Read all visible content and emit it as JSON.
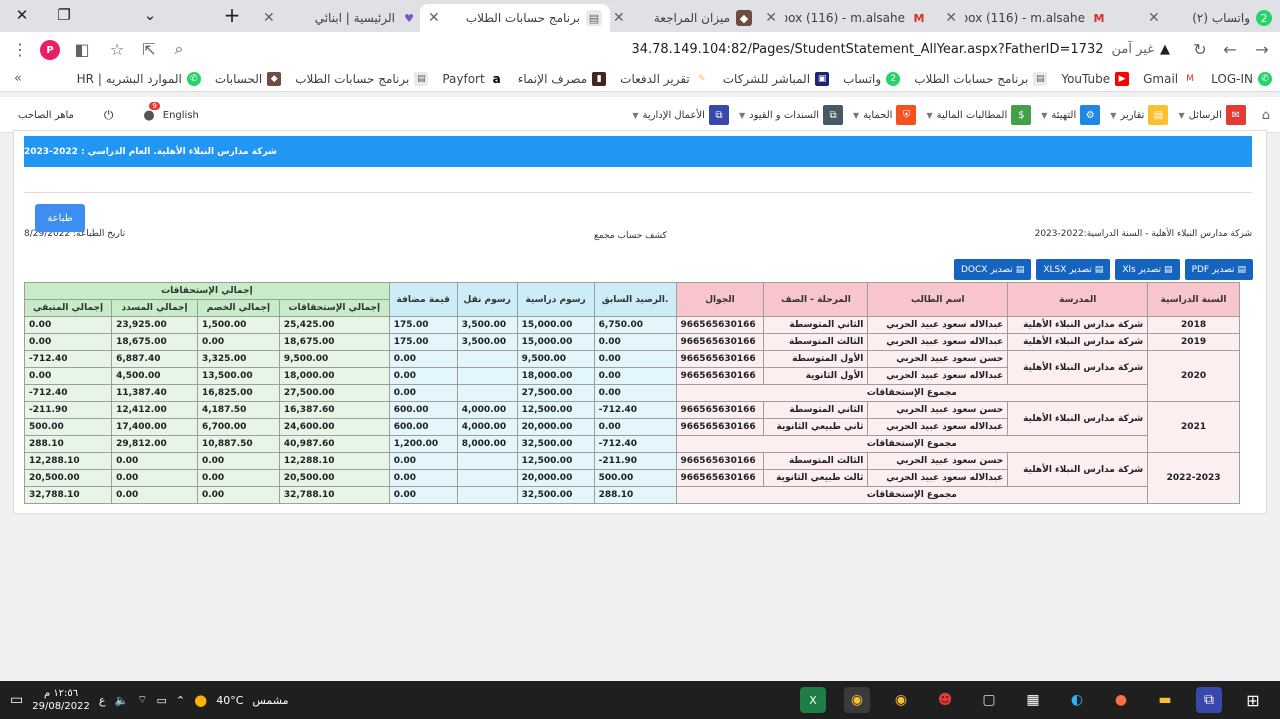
{
  "browser": {
    "tabs": [
      {
        "title": "واتساب (٢)",
        "icon": "whatsapp-icon",
        "badge": "2"
      },
      {
        "title": "Inbox (116) - m.alsahe",
        "icon": "gmail-icon"
      },
      {
        "title": "Inbox (116) - m.alsahe",
        "icon": "gmail-icon"
      },
      {
        "title": "ميزان المراجعة",
        "icon": "app-icon"
      },
      {
        "title": "برنامج حسابات الطلاب",
        "icon": "doc-icon"
      },
      {
        "title": "الرئيسية | ابنائي",
        "icon": "heart-icon"
      }
    ],
    "new_tab": "+",
    "address": {
      "security": "غير آمن",
      "url": "34.78.149.104:82/Pages/StudentStatement_AllYear.aspx?FatherID=1732"
    },
    "profile_letter": "P",
    "bookmarks": [
      "LOG-IN",
      "Gmail",
      "YouTube",
      "برنامج حسابات الطلاب",
      "واتساب",
      "المباشر للشركات",
      "تقرير الدفعات",
      "مصرف الإنماء",
      "Payfort",
      "برنامج حسابات الطلاب",
      "الحسابات",
      "الموارد البشريه | HR"
    ],
    "bookmarks_more": "»"
  },
  "app": {
    "menu": [
      "الرسائل",
      "تقارير",
      "التهيئة",
      "المطالبات المالية",
      "الحماية",
      "السندات و القيود",
      "الأعمال الإدارية"
    ],
    "lang": "English",
    "notif_count": "9",
    "user": "ماهر الصاحب",
    "colors": {
      "accent": "#2196f3",
      "export": "#1565c0"
    }
  },
  "report": {
    "header": "شركة مدارس النبلاء الأهلية. العام الدراسي : 2022-2023",
    "print_btn": "طباعة",
    "print_date": "تاريخ الطباعة: 8/29/2022",
    "title": "كشف حساب مجمع",
    "school_year": "شركة مدارس النبلاء الأهلية  - السنة الدراسية:2022-2023",
    "exports": [
      "تصدير PDF",
      "تصدير Xls",
      "تصدير XLSX",
      "تصدير DOCX"
    ],
    "columns": {
      "year": "السنة الدراسية",
      "school": "المدرسة",
      "student": "اسم الطالب",
      "grade": "المرحلة - الصف",
      "mobile": "الجوال",
      "prev": ".الرصيد السابق",
      "tuition": "رسوم دراسية",
      "transport": "رسوم نقل",
      "vat": "قيمة مضافة",
      "group": "إجمالي الإستحقاقات",
      "total_due": "إجمالي الإستحقاقات",
      "discount": "إجمالي الخصم",
      "paid": "إجمالي المسدد",
      "remaining": "إجمالي المتبقي"
    },
    "total_label": "مجموع الإستحقاقات",
    "school_name": "شركة مدارس النبلاء الأهلية",
    "groups": [
      {
        "year": "2018",
        "rows": [
          {
            "student": "عبدالاله سعود عبيد الحربي",
            "grade": "الثاني المتوسطة",
            "mobile": "966565630166",
            "prev": "6,750.00",
            "tuition": "15,000.00",
            "transport": "3,500.00",
            "vat": "175.00",
            "total_due": "25,425.00",
            "discount": "1,500.00",
            "paid": "23,925.00",
            "remaining": "0.00"
          }
        ]
      },
      {
        "year": "2019",
        "rows": [
          {
            "student": "عبدالاله سعود عبيد الحربي",
            "grade": "الثالث المتوسطة",
            "mobile": "966565630166",
            "prev": "0.00",
            "tuition": "15,000.00",
            "transport": "3,500.00",
            "vat": "175.00",
            "total_due": "18,675.00",
            "discount": "0.00",
            "paid": "18,675.00",
            "remaining": "0.00"
          }
        ]
      },
      {
        "year": "2020",
        "rows": [
          {
            "student": "حسن سعود عبيد الحربي",
            "grade": "الأول المتوسطة",
            "mobile": "966565630166",
            "prev": "0.00",
            "tuition": "9,500.00",
            "transport": "",
            "vat": "0.00",
            "total_due": "9,500.00",
            "discount": "3,325.00",
            "paid": "6,887.40",
            "remaining": "-712.40"
          },
          {
            "student": "عبدالاله سعود عبيد الحربي",
            "grade": "الأول الثانوية",
            "mobile": "966565630166",
            "prev": "0.00",
            "tuition": "18,000.00",
            "transport": "",
            "vat": "0.00",
            "total_due": "18,000.00",
            "discount": "13,500.00",
            "paid": "4,500.00",
            "remaining": "0.00"
          }
        ],
        "total": {
          "prev": "0.00",
          "tuition": "27,500.00",
          "transport": "",
          "vat": "0.00",
          "total_due": "27,500.00",
          "discount": "16,825.00",
          "paid": "11,387.40",
          "remaining": "-712.40"
        }
      },
      {
        "year": "2021",
        "rows": [
          {
            "student": "حسن سعود عبيد الحربي",
            "grade": "الثاني المتوسطة",
            "mobile": "966565630166",
            "prev": "-712.40",
            "tuition": "12,500.00",
            "transport": "4,000.00",
            "vat": "600.00",
            "total_due": "16,387.60",
            "discount": "4,187.50",
            "paid": "12,412.00",
            "remaining": "-211.90"
          },
          {
            "student": "عبدالاله سعود عبيد الحربي",
            "grade": "ثاني طبيعي الثانوية",
            "mobile": "966565630166",
            "prev": "0.00",
            "tuition": "20,000.00",
            "transport": "4,000.00",
            "vat": "600.00",
            "total_due": "24,600.00",
            "discount": "6,700.00",
            "paid": "17,400.00",
            "remaining": "500.00"
          }
        ],
        "total": {
          "prev": "-712.40",
          "tuition": "32,500.00",
          "transport": "8,000.00",
          "vat": "1,200.00",
          "total_due": "40,987.60",
          "discount": "10,887.50",
          "paid": "29,812.00",
          "remaining": "288.10"
        }
      },
      {
        "year": "2022-2023",
        "rows": [
          {
            "student": "حسن سعود عبيد الحربي",
            "grade": "الثالث المتوسطة",
            "mobile": "966565630166",
            "prev": "-211.90",
            "tuition": "12,500.00",
            "transport": "",
            "vat": "0.00",
            "total_due": "12,288.10",
            "discount": "0.00",
            "paid": "0.00",
            "remaining": "12,288.10"
          },
          {
            "student": "عبدالاله سعود عبيد الحربي",
            "grade": "ثالث طبيعي الثانوية",
            "mobile": "966565630166",
            "prev": "500.00",
            "tuition": "20,000.00",
            "transport": "",
            "vat": "0.00",
            "total_due": "20,500.00",
            "discount": "0.00",
            "paid": "0.00",
            "remaining": "20,500.00"
          }
        ],
        "total": {
          "prev": "288.10",
          "tuition": "32,500.00",
          "transport": "",
          "vat": "0.00",
          "total_due": "32,788.10",
          "discount": "0.00",
          "paid": "0.00",
          "remaining": "32,788.10"
        }
      }
    ]
  },
  "taskbar": {
    "time": "١٢:٥٦ م",
    "date": "29/08/2022",
    "lang": "ع",
    "weather": "مشمس",
    "temp": "40°C"
  }
}
